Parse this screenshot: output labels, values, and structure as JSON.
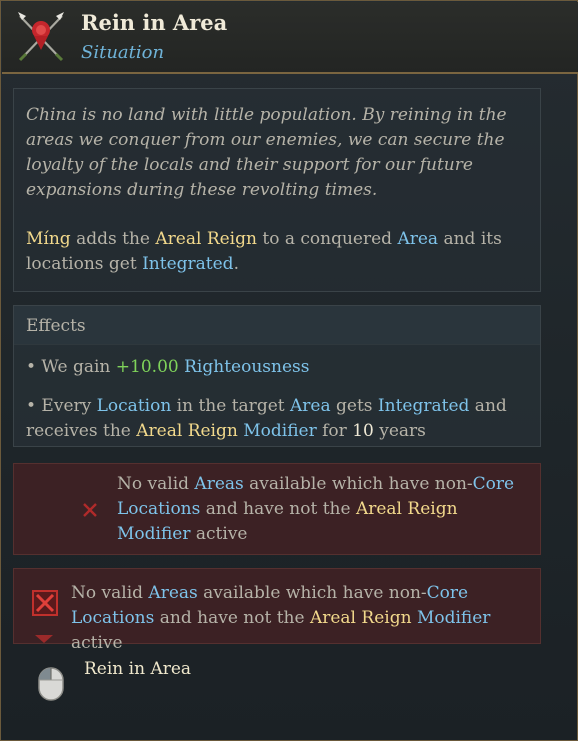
{
  "header": {
    "title": "Rein in Area",
    "subtitle": "Situation",
    "icon": "crossed-spears-seal-icon"
  },
  "description": {
    "flavor": "China is no land with little population. By reining in the areas we conquer from our enemies, we can secure the loyalty of the locals and their support for our future expansions during these revolting times.",
    "country": "Míng",
    "t1": " adds the ",
    "modifier": "Areal Reign",
    "t2": " to a conquered ",
    "area": "Area",
    "t3": " and its locations get ",
    "integrated": "Integrated",
    "t4": "."
  },
  "effects": {
    "heading": "Effects",
    "e1_prefix": "• We gain ",
    "e1_value": "+10.00",
    "e1_space": " ",
    "e1_stat": "Righteousness",
    "e2_a": "• Every ",
    "e2_location": "Location",
    "e2_b": " in the target ",
    "e2_area": "Area",
    "e2_c": " gets ",
    "e2_integrated": "Integrated",
    "e2_d": " and receives the ",
    "e2_reign": "Areal Reign",
    "e2_space": " ",
    "e2_modifier": "Modifier",
    "e2_e": " for ",
    "e2_years_num": "10",
    "e2_f": " years"
  },
  "requirement": {
    "a": "No valid ",
    "areas": "Areas",
    "b": " available which have non-",
    "core": "Core",
    "space": " ",
    "locations": "Locations",
    "c": " and have not the ",
    "reign": "Areal Reign",
    "space2": " ",
    "modifier": "Modifier",
    "d": " active"
  },
  "requirement2": {
    "a": "No valid ",
    "areas": "Areas",
    "b": " available which have non-",
    "core_locations": "Core Locations",
    "c": " and have not the ",
    "reign": "Areal Reign",
    "space": " ",
    "modifier": "Modifier",
    "d": " active"
  },
  "action": {
    "label": "Rein in Area",
    "icon": "mouse-left-click-icon"
  },
  "colors": {
    "gold": "#f2d98c",
    "blue": "#7ec3ea",
    "green": "#7fd35a",
    "failure_bg": "#3c2124",
    "failure_red": "#c0302c"
  }
}
